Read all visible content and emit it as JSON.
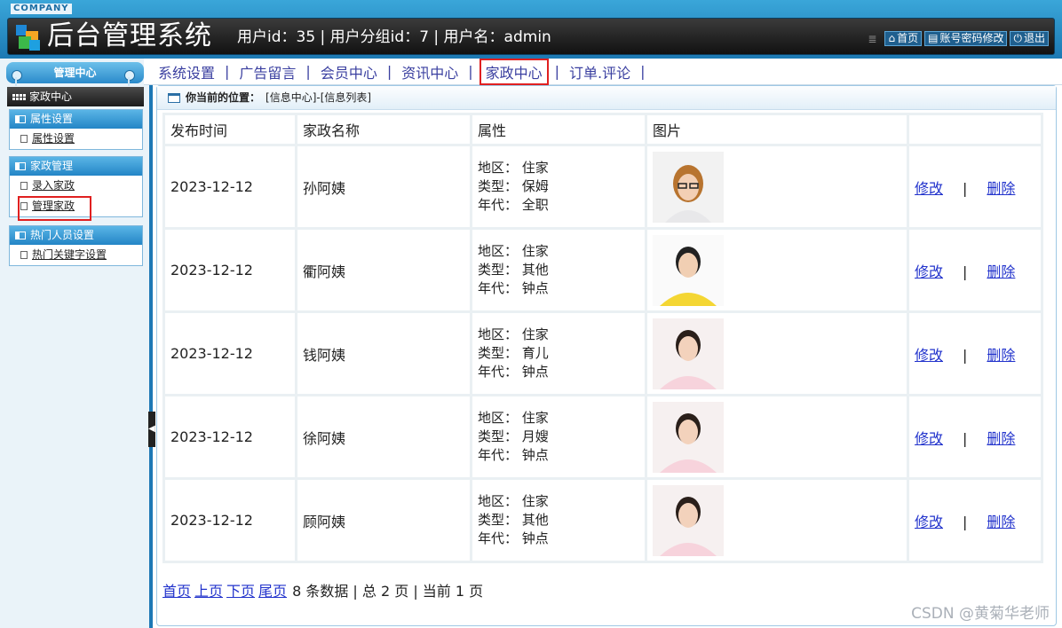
{
  "header": {
    "company": "COMPANY",
    "title": "后台管理系统",
    "user_info": "用户id：35 | 用户分组id：7 | 用户名：admin",
    "links": [
      "首页",
      "账号密码修改",
      "退出"
    ]
  },
  "sidebar": {
    "head": "管理中心",
    "active": "家政中心",
    "groups": [
      {
        "title": "属性设置",
        "items": [
          "属性设置"
        ]
      },
      {
        "title": "家政管理",
        "items": [
          "录入家政",
          "管理家政"
        ]
      },
      {
        "title": "热门人员设置",
        "items": [
          "热门关键字设置"
        ]
      }
    ]
  },
  "tabs": [
    "系统设置",
    "广告留言",
    "会员中心",
    "资讯中心",
    "家政中心",
    "订单.评论"
  ],
  "active_tab": "家政中心",
  "breadcrumb": {
    "label": "你当前的位置：",
    "path": "[信息中心]-[信息列表]"
  },
  "table": {
    "headers": [
      "发布时间",
      "家政名称",
      "属性",
      "图片",
      ""
    ],
    "attr_labels": {
      "region": "地区：",
      "type": "类型：",
      "era": "年代："
    },
    "rows": [
      {
        "date": "2023-12-12",
        "name": "孙阿姨",
        "region": "住家",
        "type": "保姆",
        "era": "全职",
        "photo": "woman-glasses-photo"
      },
      {
        "date": "2023-12-12",
        "name": "衢阿姨",
        "region": "住家",
        "type": "其他",
        "era": "钟点",
        "photo": "woman-yellow-shirt-photo"
      },
      {
        "date": "2023-12-12",
        "name": "钱阿姨",
        "region": "住家",
        "type": "育儿",
        "era": "钟点",
        "photo": "woman-pink-uniform-photo"
      },
      {
        "date": "2023-12-12",
        "name": "徐阿姨",
        "region": "住家",
        "type": "月嫂",
        "era": "钟点",
        "photo": "woman-pink-uniform-photo"
      },
      {
        "date": "2023-12-12",
        "name": "顾阿姨",
        "region": "住家",
        "type": "其他",
        "era": "钟点",
        "photo": "woman-pink-uniform-photo"
      }
    ],
    "edit_label": "修改",
    "sep": "|",
    "delete_label": "删除"
  },
  "pager": {
    "first": "首页",
    "prev": "上页",
    "next": "下页",
    "last": "尾页",
    "summary": "8 条数据 | 总 2 页 | 当前 1 页"
  },
  "watermark": "CSDN @黄菊华老师",
  "colors": {
    "header": "#1c79b3",
    "active_border": "#e02020",
    "link": "#2233cc"
  }
}
